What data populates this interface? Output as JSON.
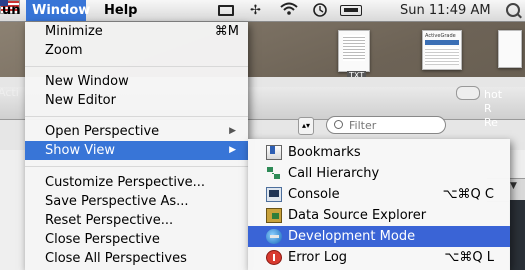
{
  "menubar": {
    "items": [
      {
        "label": "un"
      },
      {
        "label": "Window"
      },
      {
        "label": "Help"
      }
    ],
    "clock": "Sun 11:49 AM",
    "tray_icons": [
      "display-icon",
      "bluetooth-icon",
      "wifi-icon",
      "timemachine-icon",
      "battery-icon",
      "us-flag-icon",
      "search-icon"
    ]
  },
  "background": {
    "label_acti": "Acti",
    "label_hot": "hot\nR\nRe",
    "filter_placeholder": "Filter",
    "txt_label": "TXT",
    "sheet_title": "ActiveGrade"
  },
  "window_menu": {
    "items": [
      {
        "label": "Minimize",
        "shortcut": "⌘M"
      },
      {
        "label": "Zoom",
        "shortcut": ""
      },
      {
        "label": "New Window",
        "shortcut": ""
      },
      {
        "label": "New Editor",
        "shortcut": ""
      },
      {
        "label": "Open Perspective",
        "submenu": true
      },
      {
        "label": "Show View",
        "submenu": true,
        "selected": true
      },
      {
        "label": "Customize Perspective...",
        "shortcut": ""
      },
      {
        "label": "Save Perspective As...",
        "shortcut": ""
      },
      {
        "label": "Reset Perspective...",
        "shortcut": ""
      },
      {
        "label": "Close Perspective",
        "shortcut": ""
      },
      {
        "label": "Close All Perspectives",
        "shortcut": ""
      }
    ],
    "arrow_glyph": "▶"
  },
  "show_view_menu": {
    "items": [
      {
        "label": "Bookmarks",
        "shortcut": "",
        "icon": "bookmarks-icon"
      },
      {
        "label": "Call Hierarchy",
        "shortcut": "",
        "icon": "call-hierarchy-icon"
      },
      {
        "label": "Console",
        "shortcut": "⌥⌘Q C",
        "icon": "console-icon"
      },
      {
        "label": "Data Source Explorer",
        "shortcut": "",
        "icon": "data-source-explorer-icon"
      },
      {
        "label": "Development Mode",
        "shortcut": "",
        "icon": "development-mode-icon",
        "selected": true
      },
      {
        "label": "Error Log",
        "shortcut": "⌥⌘Q L",
        "icon": "error-log-icon"
      }
    ]
  },
  "colors": {
    "selection": "#3875d7",
    "submenu_selection": "#3a64d6"
  }
}
